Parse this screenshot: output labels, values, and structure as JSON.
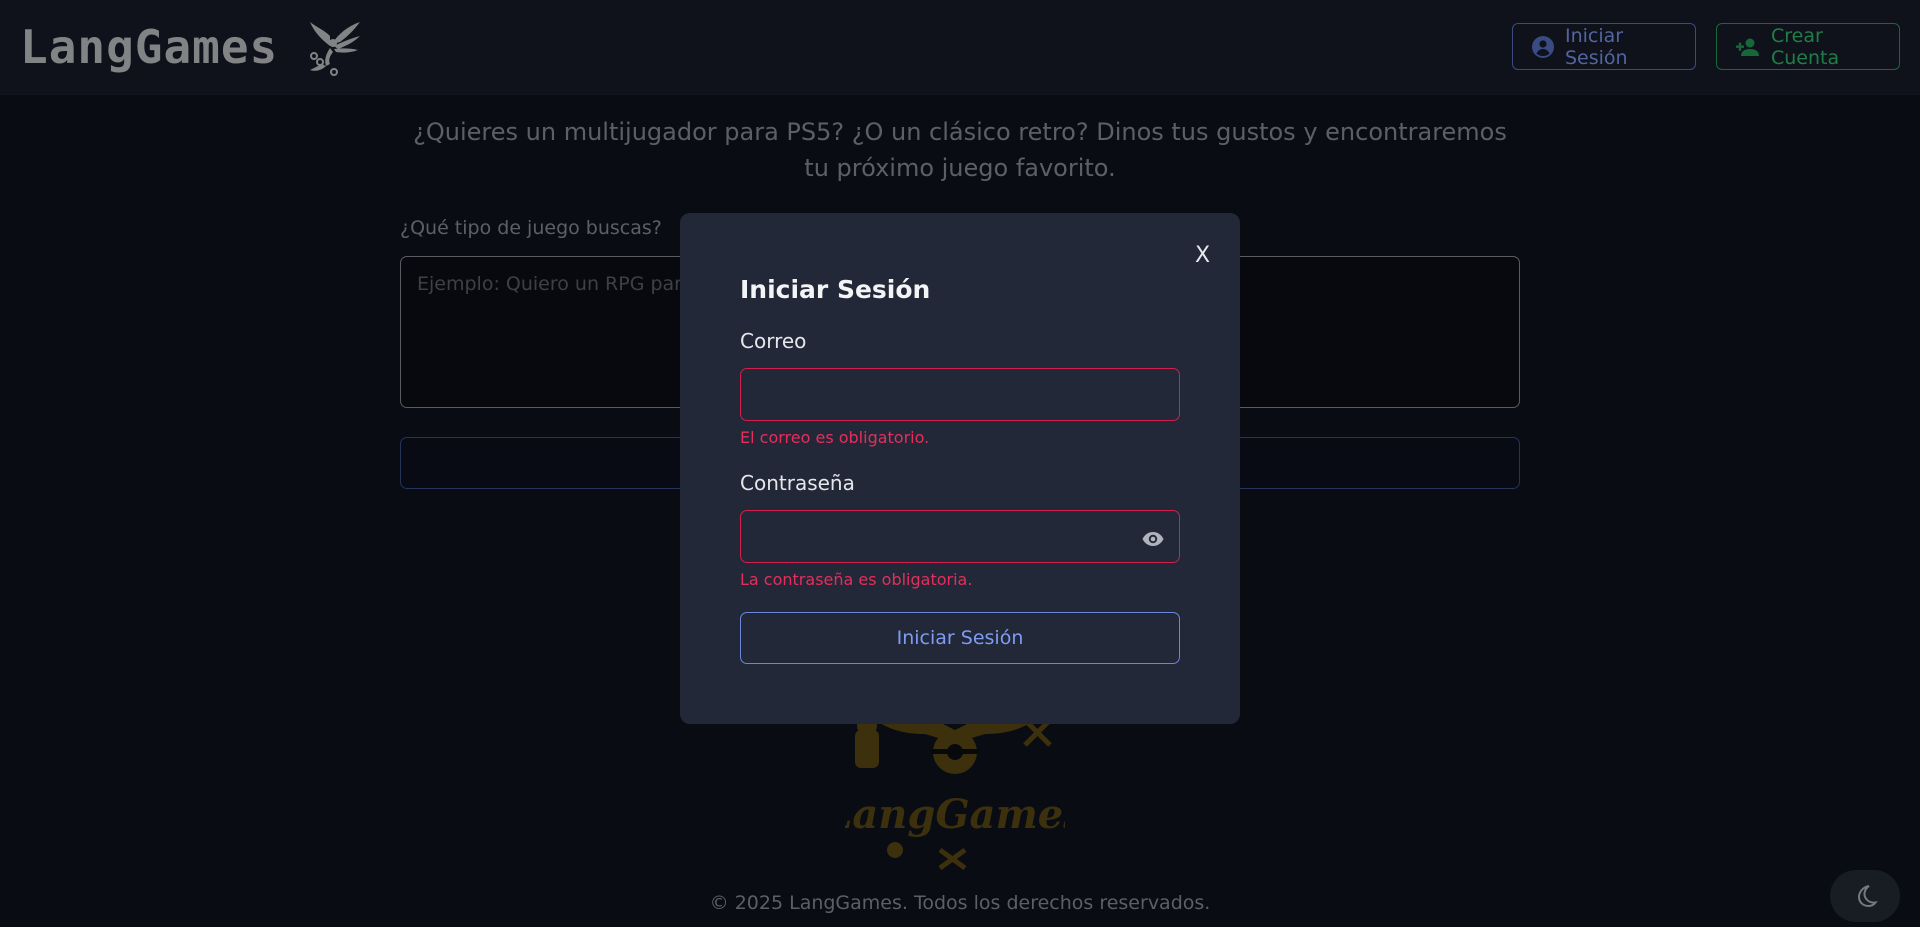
{
  "header": {
    "brand": "LangGames",
    "login_label": "Iniciar Sesión",
    "register_label": "Crear Cuenta"
  },
  "main": {
    "intro": "¿Quieres un multijugador para PS5? ¿O un clásico retro? Dinos tus gustos y encontraremos tu próximo juego favorito.",
    "query_label": "¿Qué tipo de juego buscas?",
    "query_placeholder": "Ejemplo: Quiero un RPG para",
    "crest_text": "LangGames"
  },
  "footer": {
    "copyright": "© 2025 LangGames. Todos los derechos reservados."
  },
  "modal": {
    "close_label": "X",
    "title": "Iniciar Sesión",
    "email_label": "Correo",
    "email_value": "",
    "email_error": "El correo es obligatorio.",
    "password_label": "Contraseña",
    "password_value": "",
    "password_error": "La contraseña es obligatoria.",
    "submit_label": "Iniciar Sesión"
  },
  "icons": {
    "login": "user-circle-icon",
    "register": "person-add-icon",
    "brand": "phoenix-icon",
    "password_toggle": "eye-icon",
    "theme": "moon-icon"
  },
  "colors": {
    "page_bg": "#0f131e",
    "modal_bg": "#222837",
    "accent_blue": "#7f9cf5",
    "accent_green": "#34c06f",
    "error": "#e62e5c",
    "crest_gold": "#5c4a14"
  }
}
